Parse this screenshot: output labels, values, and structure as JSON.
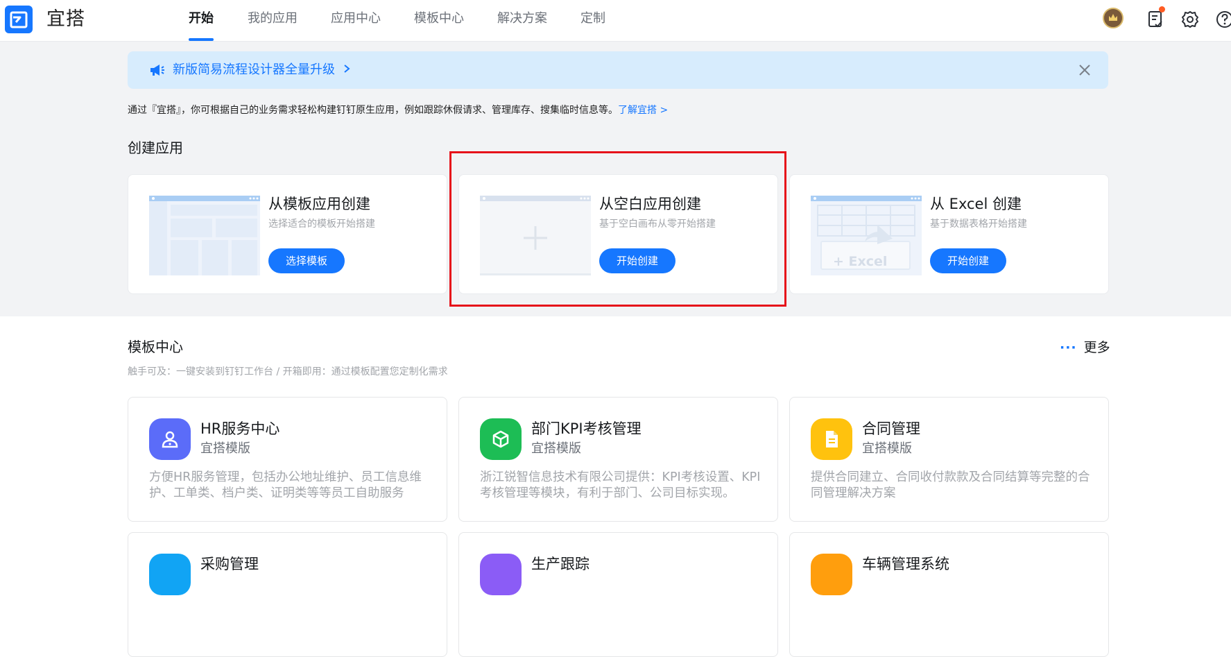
{
  "app": {
    "name": "宜搭"
  },
  "nav": {
    "items": [
      {
        "label": "开始"
      },
      {
        "label": "我的应用"
      },
      {
        "label": "应用中心"
      },
      {
        "label": "模板中心"
      },
      {
        "label": "解决方案"
      },
      {
        "label": "定制"
      }
    ],
    "active_index": 0
  },
  "header_icons": [
    "avatar-crown-icon",
    "todo-list-icon",
    "settings-gear-icon",
    "help-icon"
  ],
  "banner": {
    "text": "新版简易流程设计器全量升级",
    "icon": "megaphone-icon",
    "close_icon": "close-icon"
  },
  "intro": {
    "text": "通过『宜搭』，你可根据自己的业务需求轻松构建钉钉原生应用，例如跟踪休假请求、管理库存、搜集临时信息等。",
    "link": "了解宜搭 >"
  },
  "create_section": {
    "title": "创建应用",
    "cards": [
      {
        "title": "从模板应用创建",
        "subtitle": "选择适合的模板开始搭建",
        "button": "选择模板"
      },
      {
        "title": "从空白应用创建",
        "subtitle": "基于空白画布从零开始搭建",
        "button": "开始创建"
      },
      {
        "title": "从 Excel 创建",
        "subtitle": "基于数据表格开始搭建",
        "button": "开始创建",
        "thumb_text": "+ Excel"
      }
    ]
  },
  "template_center": {
    "title": "模板中心",
    "more": "更多",
    "subtitle": "触手可及：一键安装到钉钉工作台 / 开箱即用：通过模板配置您定制化需求",
    "templates": [
      {
        "name": "HR服务中心",
        "tag": "宜搭模版",
        "desc": "方便HR服务管理，包括办公地址维护、员工信息维护、工单类、档户类、证明类等等员工自助服务",
        "color": "#5b6cf9",
        "icon": "person-icon"
      },
      {
        "name": "部门KPI考核管理",
        "tag": "宜搭模版",
        "desc": "浙江锐智信息技术有限公司提供：KPI考核设置、KPI考核管理等模块，有利于部门、公司目标实现。",
        "color": "#1dbd55",
        "icon": "cube-icon"
      },
      {
        "name": "合同管理",
        "tag": "宜搭模版",
        "desc": "提供合同建立、合同收付款款及合同结算等完整的合同管理解决方案",
        "color": "#ffc20e",
        "icon": "document-icon"
      },
      {
        "name": "采购管理",
        "tag": "",
        "desc": "",
        "color": "#11a4f4",
        "icon": "cart-icon"
      },
      {
        "name": "生产跟踪",
        "tag": "",
        "desc": "",
        "color": "#8b5cf6",
        "icon": "factory-icon"
      },
      {
        "name": "车辆管理系统",
        "tag": "",
        "desc": "",
        "color": "#ff9e0d",
        "icon": "car-icon"
      }
    ]
  },
  "colors": {
    "accent": "#1677ff",
    "page_bg": "#f2f3f5",
    "highlight": "#e6121a"
  }
}
